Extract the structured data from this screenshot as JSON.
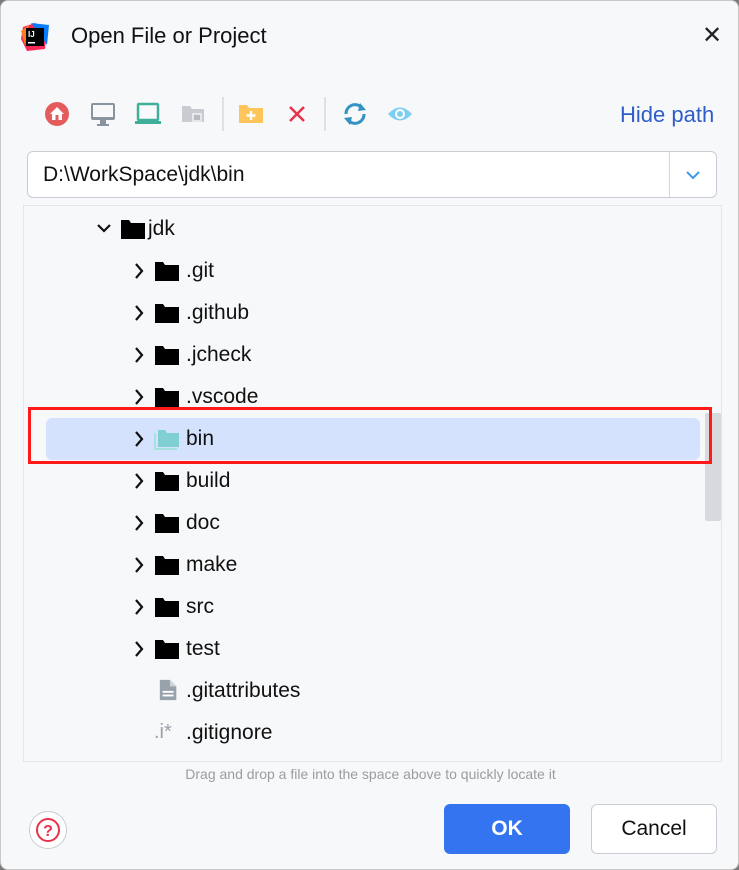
{
  "window": {
    "title": "Open File or Project",
    "close_icon": "close-icon"
  },
  "toolbar": {
    "buttons": [
      {
        "name": "home",
        "icon": "home-icon",
        "color": "#e55c5c"
      },
      {
        "name": "desktop",
        "icon": "desktop-icon",
        "color": "#8a949e"
      },
      {
        "name": "project",
        "icon": "laptop-icon",
        "color": "#3fae9a"
      },
      {
        "name": "module",
        "icon": "module-folder-icon",
        "color": "#b7bbc0"
      },
      {
        "name": "new-folder",
        "icon": "new-folder-icon",
        "color": "#fdc55a"
      },
      {
        "name": "delete",
        "icon": "delete-icon",
        "color": "#e8324a"
      },
      {
        "name": "refresh",
        "icon": "refresh-icon",
        "color": "#3592c4"
      },
      {
        "name": "show-hidden",
        "icon": "eye-icon",
        "color": "#7dcdf3"
      }
    ],
    "hide_path": "Hide path"
  },
  "path": {
    "value": "D:\\WorkSpace\\jdk\\bin"
  },
  "tree": {
    "items": [
      {
        "label": "jdk",
        "type": "folder",
        "expanded": true,
        "level": 0
      },
      {
        "label": ".git",
        "type": "folder",
        "level": 1
      },
      {
        "label": ".github",
        "type": "folder",
        "level": 1
      },
      {
        "label": ".jcheck",
        "type": "folder",
        "level": 1
      },
      {
        "label": ".vscode",
        "type": "folder",
        "level": 1
      },
      {
        "label": "bin",
        "type": "folder",
        "level": 1,
        "selected": true
      },
      {
        "label": "build",
        "type": "folder",
        "level": 1
      },
      {
        "label": "doc",
        "type": "folder",
        "level": 1
      },
      {
        "label": "make",
        "type": "folder",
        "level": 1
      },
      {
        "label": "src",
        "type": "folder",
        "level": 1
      },
      {
        "label": "test",
        "type": "folder",
        "level": 1
      },
      {
        "label": ".gitattributes",
        "type": "text-file",
        "level": 1
      },
      {
        "label": ".gitignore",
        "type": "ignore-file",
        "level": 1
      }
    ]
  },
  "hint": "Drag and drop a file into the space above to quickly locate it",
  "footer": {
    "ok": "OK",
    "cancel": "Cancel"
  },
  "colors": {
    "accent": "#3574f0",
    "selection": "#d4e2fd",
    "highlight_box": "#ff1a1a",
    "link": "#2f5dc8"
  }
}
